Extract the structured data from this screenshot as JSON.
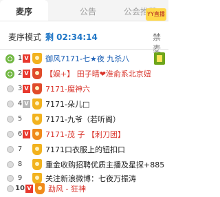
{
  "tabs": [
    {
      "label": "麦序"
    },
    {
      "label": "公告"
    },
    {
      "label": "公会推荐"
    }
  ],
  "logo_text": "YY直播",
  "mode": {
    "label": "麦序模式",
    "timer": "剩 02:34:14",
    "rules_link": "禁麦"
  },
  "queue": [
    {
      "num": "1",
      "name": "御风7171-七★夜 九杀八"
    },
    {
      "num": "2",
      "name": "【娱+】 田子晴❤淮俞系北京妞"
    },
    {
      "num": "3",
      "name": "7171-魔神六"
    },
    {
      "num": "4",
      "name": "7171-朵儿□"
    },
    {
      "num": "5",
      "name": "7171-九爷（若听阁）"
    },
    {
      "num": "6",
      "name": "7171-茂 子 【刺刀团】"
    },
    {
      "num": "7",
      "name": "7171口衣服上的钮扣口"
    },
    {
      "num": "8",
      "name": "重金收购招聘优质主播及星探+885"
    },
    {
      "num": "9",
      "name": "关注新浪微博：七夜万振涛"
    },
    {
      "num": "10.",
      "name": "勐风 - 狂神"
    }
  ],
  "colors": {
    "accent_blue": "#1f76c6",
    "name_red": "#d9342b",
    "name_blue": "#1b5fb5",
    "vip_red": "#e8382e"
  }
}
